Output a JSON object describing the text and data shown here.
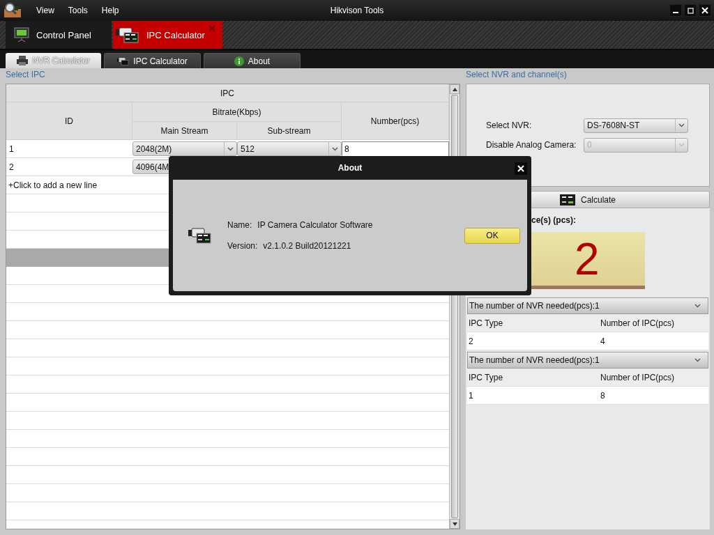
{
  "window": {
    "title": "Hikvison Tools"
  },
  "menu": [
    "View",
    "Tools",
    "Help"
  ],
  "module_tabs": [
    {
      "label": "Control Panel",
      "selected": false
    },
    {
      "label": "IPC Calculator",
      "selected": true
    }
  ],
  "tabs": [
    {
      "label": "NVR Calculator",
      "selected": true
    },
    {
      "label": "IPC Calculator",
      "selected": false
    },
    {
      "label": "About",
      "selected": false
    }
  ],
  "ipc": {
    "title": "Select IPC",
    "header": "IPC",
    "id_column": "ID",
    "bitrate_header": "Bitrate(Kbps)",
    "main_column": "Main Stream",
    "sub_column": "Sub-stream",
    "number_column": "Number(pcs)",
    "rows": [
      {
        "id": "1",
        "main": "2048(2M)",
        "sub": "512",
        "number": "8"
      },
      {
        "id": "2",
        "main": "4096(4M"
      }
    ],
    "add_line": "+Click to add a new line"
  },
  "nvr": {
    "title": "Select NVR and channel(s)",
    "fields": [
      {
        "label": "Select NVR:",
        "value": "DS-7608N-ST",
        "disabled": false
      },
      {
        "label": "Disable Analog Camera:",
        "value": "0",
        "disabled": true
      }
    ],
    "calculate": "Calculate",
    "result_label": "ce(s)  (pcs):",
    "result_value": "2",
    "groups": [
      {
        "title": "The number of NVR needed(pcs):1",
        "columns": [
          "IPC Type",
          "Number of IPC(pcs)"
        ],
        "rows": [
          [
            "2",
            "4"
          ]
        ]
      },
      {
        "title": "The number of NVR needed(pcs):1",
        "columns": [
          "IPC Type",
          "Number of IPC(pcs)"
        ],
        "rows": [
          [
            "1",
            "8"
          ]
        ]
      }
    ]
  },
  "dialog": {
    "title": "About",
    "lines": [
      {
        "label": "Name:",
        "value": "IP Camera Calculator Software"
      },
      {
        "label": "Version:",
        "value": "v2.1.0.2 Build20121221"
      }
    ],
    "ok": "OK"
  }
}
